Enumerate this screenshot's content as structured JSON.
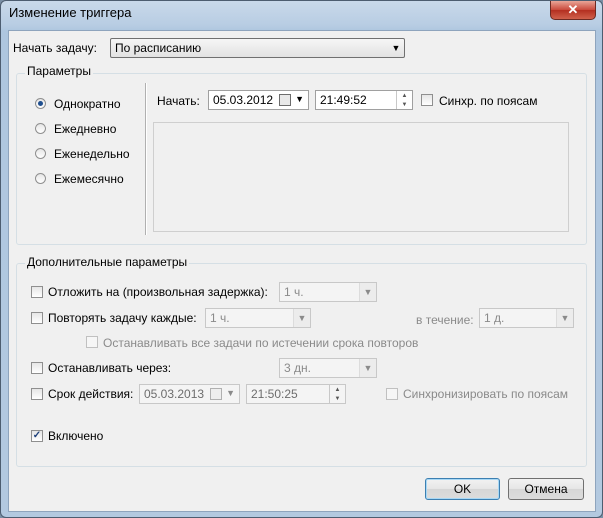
{
  "window": {
    "title": "Изменение триггера",
    "close_glyph": "✕"
  },
  "begin_task": {
    "label": "Начать задачу:",
    "value": "По расписанию"
  },
  "parameters": {
    "title": "Параметры",
    "radios": [
      {
        "label": "Однократно",
        "selected": true
      },
      {
        "label": "Ежедневно",
        "selected": false
      },
      {
        "label": "Еженедельно",
        "selected": false
      },
      {
        "label": "Ежемесячно",
        "selected": false
      }
    ],
    "start_label": "Начать:",
    "start_date": "05.03.2012",
    "start_time": "21:49:52",
    "sync_label": "Синхр. по поясам"
  },
  "advanced": {
    "title": "Дополнительные параметры",
    "delay_label": "Отложить на (произвольная задержка):",
    "delay_value": "1 ч.",
    "repeat_label": "Повторять задачу каждые:",
    "repeat_value": "1 ч.",
    "duration_label": "в течение:",
    "duration_value": "1 д.",
    "stop_all_label": "Останавливать все задачи по истечении срока повторов",
    "stop_after_label": "Останавливать через:",
    "stop_after_value": "3 дн.",
    "expire_label": "Срок действия:",
    "expire_date": "05.03.2013",
    "expire_time": "21:50:25",
    "expire_sync_label": "Синхронизировать по поясам",
    "enabled_label": "Включено",
    "enabled_check": "✓"
  },
  "buttons": {
    "ok": "OK",
    "cancel": "Отмена"
  },
  "glyphs": {
    "dropdown": "▼",
    "spin_up": "▲",
    "spin_down": "▼"
  }
}
